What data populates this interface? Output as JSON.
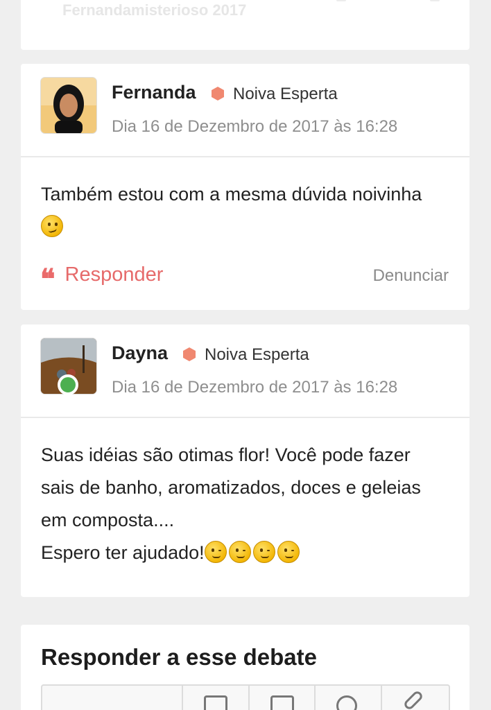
{
  "previous_card": {
    "text": "Fernandamisterioso 2017"
  },
  "posts": [
    {
      "author": "Fernanda",
      "role": "Noiva Esperta",
      "date": "Dia 16 de Dezembro de 2017 às 16:28",
      "body": "Também estou com a mesma dúvida noivinha",
      "emoji": "thinking-face",
      "reply_label": "Responder",
      "report_label": "Denunciar",
      "online": false
    },
    {
      "author": "Dayna",
      "role": "Noiva Esperta",
      "date": "Dia 16 de Dezembro de 2017 às 16:28",
      "body_lines": [
        "Suas idéias são otimas flor! Você pode fazer",
        "sais de banho, aromatizados, doces e geleias",
        "em composta....",
        "Espero ter ajudado!"
      ],
      "emoji": "winking-face",
      "emoji_count": 4,
      "online": true
    }
  ],
  "compose": {
    "title": "Responder a esse debate",
    "toolbar_icons": [
      "image-icon",
      "video-icon",
      "emoji-icon",
      "link-icon"
    ]
  },
  "colors": {
    "accent": "#e66a6a",
    "badge": "#f08870",
    "online": "#4caf50"
  }
}
